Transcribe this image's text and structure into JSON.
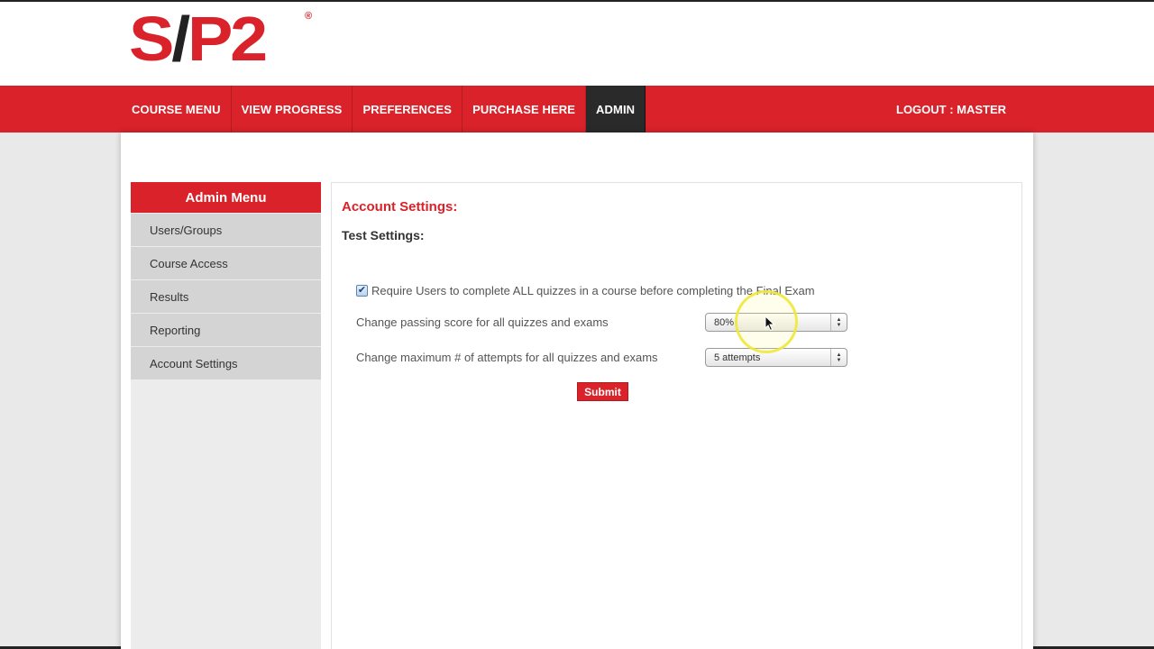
{
  "logo": {
    "letters": "S",
    "slash": "/",
    "rest": "P2",
    "reg": "®"
  },
  "nav": {
    "items": [
      "COURSE MENU",
      "VIEW PROGRESS",
      "PREFERENCES",
      "PURCHASE HERE",
      "ADMIN"
    ],
    "active": "ADMIN",
    "logout": "LOGOUT : MASTER"
  },
  "sidebar": {
    "title": "Admin Menu",
    "items": [
      "Users/Groups",
      "Course Access",
      "Results",
      "Reporting",
      "Account Settings"
    ]
  },
  "main": {
    "title": "Account Settings:",
    "subtitle": "Test Settings:",
    "require_label": "Require Users to complete ALL quizzes in a course before completing the Final Exam",
    "require_checked": true,
    "passing_label": "Change passing score for all quizzes and exams",
    "passing_value": "80%",
    "attempts_label": "Change maximum # of attempts for all quizzes and exams",
    "attempts_value": "5 attempts",
    "submit_label": "Submit"
  },
  "colors": {
    "brand_red": "#d9222a",
    "active_nav": "#2a2a2a"
  }
}
